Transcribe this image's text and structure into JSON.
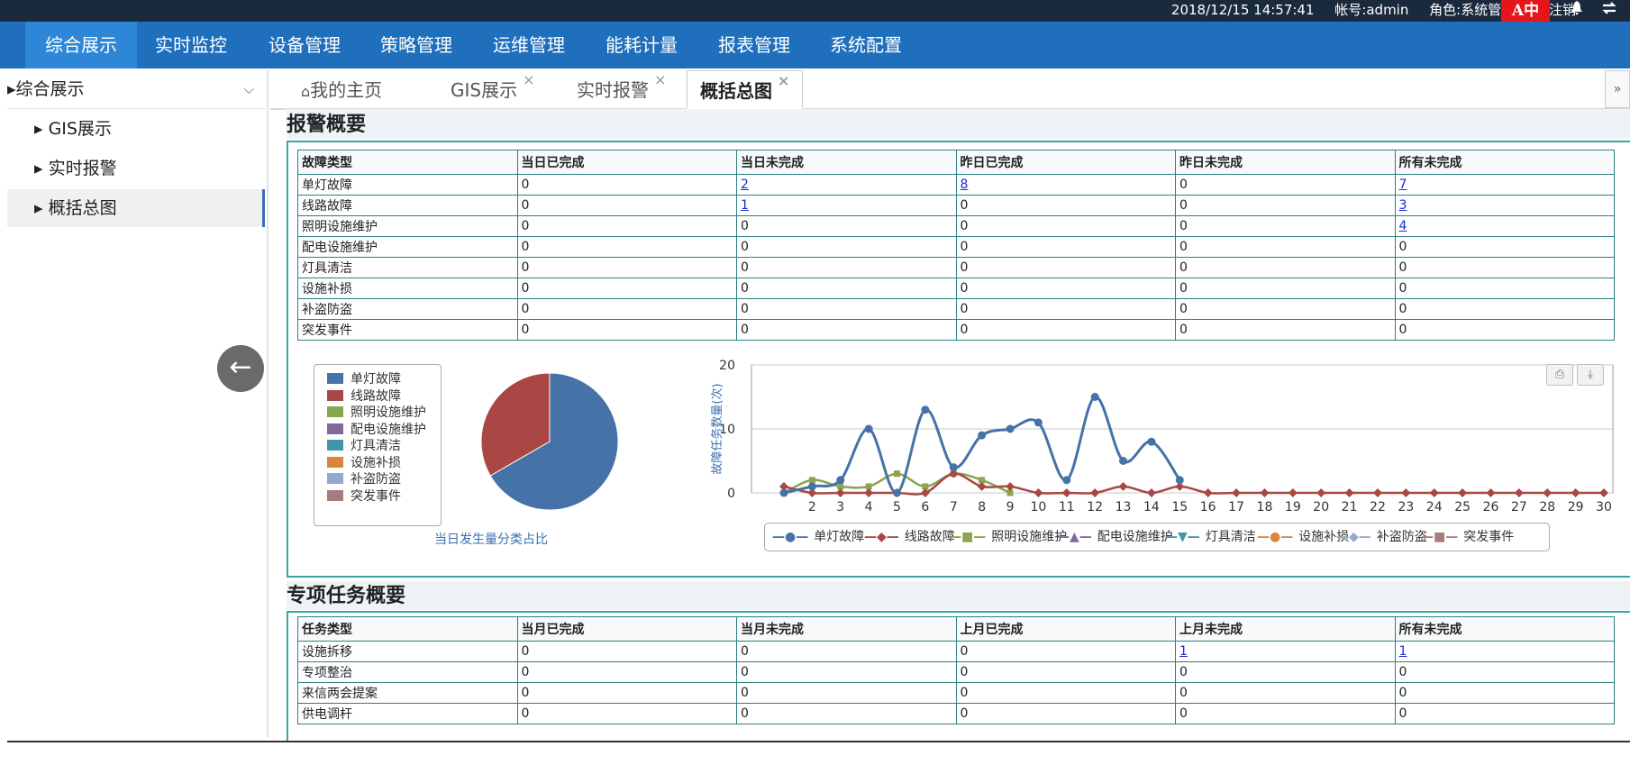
{
  "topbar": {
    "datetime": "2018/12/15 14:57:41",
    "account": "帐号:admin",
    "role": "角色:系统管理员",
    "logout": "注销",
    "lang": "A中",
    "bell_icon": "bell-icon",
    "switch_icon": "swap-icon"
  },
  "nav": [
    "综合展示",
    "实时监控",
    "设备管理",
    "策略管理",
    "运维管理",
    "能耗计量",
    "报表管理",
    "系统配置"
  ],
  "sidebar": {
    "group": "▸综合展示",
    "items": [
      "▸ GIS展示",
      "▸ 实时报警",
      "▸ 概括总图"
    ]
  },
  "tabs": {
    "home": "我的主页",
    "items": [
      "GIS展示",
      "实时报警",
      "概括总图"
    ],
    "close": "×"
  },
  "alarm": {
    "title": "报警概要",
    "headers": [
      "故障类型",
      "当日已完成",
      "当日未完成",
      "昨日已完成",
      "昨日未完成",
      "所有未完成"
    ],
    "rows": [
      [
        "单灯故障",
        "0",
        "2",
        "8",
        "0",
        "7"
      ],
      [
        "线路故障",
        "0",
        "1",
        "0",
        "0",
        "3"
      ],
      [
        "照明设施维护",
        "0",
        "0",
        "0",
        "0",
        "4"
      ],
      [
        "配电设施维护",
        "0",
        "0",
        "0",
        "0",
        "0"
      ],
      [
        "灯具清洁",
        "0",
        "0",
        "0",
        "0",
        "0"
      ],
      [
        "设施补损",
        "0",
        "0",
        "0",
        "0",
        "0"
      ],
      [
        "补盗防盗",
        "0",
        "0",
        "0",
        "0",
        "0"
      ],
      [
        "突发事件",
        "0",
        "0",
        "0",
        "0",
        "0"
      ]
    ],
    "links": [
      [
        0,
        2
      ],
      [
        0,
        3
      ],
      [
        0,
        5
      ],
      [
        1,
        2
      ],
      [
        1,
        5
      ],
      [
        2,
        5
      ]
    ]
  },
  "pie_caption": "当日发生量分类占比",
  "special": {
    "title": "专项任务概要",
    "headers": [
      "任务类型",
      "当月已完成",
      "当月未完成",
      "上月已完成",
      "上月未完成",
      "所有未完成"
    ],
    "rows": [
      [
        "设施拆移",
        "0",
        "0",
        "0",
        "1",
        "1"
      ],
      [
        "专项整治",
        "0",
        "0",
        "0",
        "0",
        "0"
      ],
      [
        "来信两会提案",
        "0",
        "0",
        "0",
        "0",
        "0"
      ],
      [
        "供电调杆",
        "0",
        "0",
        "0",
        "0",
        "0"
      ]
    ],
    "links": [
      [
        0,
        4
      ],
      [
        0,
        5
      ]
    ]
  },
  "colors": {
    "single_lamp": "#4572a7",
    "line": "#aa4643",
    "lighting": "#89a54e",
    "distribution": "#80699b",
    "cleaning": "#3d96ae",
    "repair": "#db843d",
    "theft": "#92a8cd",
    "emergency": "#a47d7c"
  },
  "chart_data": [
    {
      "type": "pie",
      "title": "当日发生量分类占比",
      "categories": [
        "单灯故障",
        "线路故障",
        "照明设施维护",
        "配电设施维护",
        "灯具清洁",
        "设施补损",
        "补盗防盗",
        "突发事件"
      ],
      "values": [
        2,
        1,
        0,
        0,
        0,
        0,
        0,
        0
      ],
      "colors": [
        "#4572a7",
        "#aa4643",
        "#89a54e",
        "#80699b",
        "#3d96ae",
        "#db843d",
        "#92a8cd",
        "#a47d7c"
      ],
      "legend": "left"
    },
    {
      "type": "line",
      "ylabel": "故障任务数量(次)",
      "ylim": [
        0,
        20
      ],
      "yticks": [
        0,
        10,
        20
      ],
      "x": [
        1,
        2,
        3,
        4,
        5,
        6,
        7,
        8,
        9,
        10,
        11,
        12,
        13,
        14,
        15,
        16,
        17,
        18,
        19,
        20,
        21,
        22,
        23,
        24,
        25,
        26,
        27,
        28,
        29,
        30
      ],
      "xtick_labels": [
        "2",
        "3",
        "4",
        "5",
        "6",
        "7",
        "8",
        "9",
        "10",
        "11",
        "12",
        "13",
        "14",
        "15",
        "16",
        "17",
        "18",
        "19",
        "20",
        "21",
        "22",
        "23",
        "24",
        "25",
        "26",
        "27",
        "28",
        "29",
        "30"
      ],
      "series": [
        {
          "name": "单灯故障",
          "color": "#4572a7",
          "values": [
            0,
            1,
            2,
            10,
            0,
            13,
            4,
            9,
            10,
            11,
            2,
            15,
            5,
            8,
            2
          ]
        },
        {
          "name": "线路故障",
          "color": "#aa4643",
          "values": [
            1,
            0,
            0,
            0,
            0,
            0,
            3,
            1,
            1,
            0,
            0,
            0,
            1,
            0,
            1,
            0,
            0,
            0,
            0,
            0,
            0,
            0,
            0,
            0,
            0,
            0,
            0,
            0,
            0,
            0
          ]
        },
        {
          "name": "照明设施维护",
          "color": "#89a54e",
          "values": [
            0,
            2,
            1,
            1,
            3,
            1,
            3,
            2,
            0
          ]
        },
        {
          "name": "配电设施维护",
          "color": "#80699b",
          "values": []
        },
        {
          "name": "灯具清洁",
          "color": "#3d96ae",
          "values": []
        },
        {
          "name": "设施补损",
          "color": "#db843d",
          "values": []
        },
        {
          "name": "补盗防盗",
          "color": "#92a8cd",
          "values": []
        },
        {
          "name": "突发事件",
          "color": "#a47d7c",
          "values": []
        }
      ],
      "legend": "bottom",
      "grid": true,
      "tools": [
        "print-icon",
        "download-icon"
      ]
    }
  ]
}
